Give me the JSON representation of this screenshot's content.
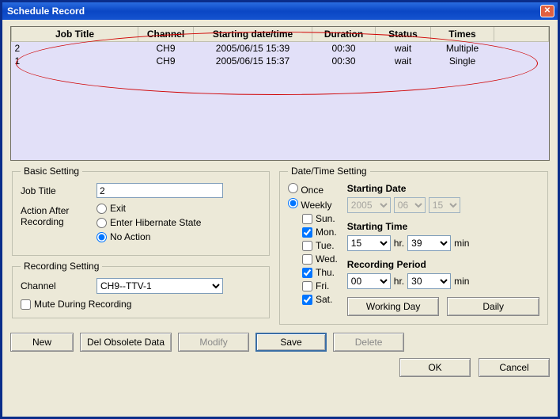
{
  "window": {
    "title": "Schedule Record"
  },
  "table": {
    "headers": {
      "job_title": "Job Title",
      "channel": "Channel",
      "starting": "Starting date/time",
      "duration": "Duration",
      "status": "Status",
      "times": "Times"
    },
    "rows": [
      {
        "job_title": "2",
        "channel": "CH9",
        "starting": "2005/06/15 15:39",
        "duration": "00:30",
        "status": "wait",
        "times": "Multiple"
      },
      {
        "job_title": "1",
        "channel": "CH9",
        "starting": "2005/06/15 15:37",
        "duration": "00:30",
        "status": "wait",
        "times": "Single"
      }
    ]
  },
  "basic": {
    "legend": "Basic Setting",
    "job_title_label": "Job Title",
    "job_title_value": "2",
    "action_label": "Action After Recording",
    "opt_exit": "Exit",
    "opt_hibernate": "Enter Hibernate State",
    "opt_noaction": "No Action"
  },
  "recording": {
    "legend": "Recording Setting",
    "channel_label": "Channel",
    "channel_value": "CH9--TTV-1",
    "mute_label": "Mute During Recording"
  },
  "datetime": {
    "legend": "Date/Time Setting",
    "once_label": "Once",
    "weekly_label": "Weekly",
    "days": {
      "sun": "Sun.",
      "mon": "Mon.",
      "tue": "Tue.",
      "wed": "Wed.",
      "thu": "Thu.",
      "fri": "Fri.",
      "sat": "Sat."
    },
    "starting_date_label": "Starting Date",
    "date_year": "2005",
    "date_month": "06",
    "date_day": "15",
    "starting_time_label": "Starting Time",
    "time_hr": "15",
    "time_min": "39",
    "hr_label": "hr.",
    "min_label": "min",
    "period_label": "Recording Period",
    "period_hr": "00",
    "period_min": "30",
    "working_day_btn": "Working Day",
    "daily_btn": "Daily"
  },
  "buttons": {
    "new": "New",
    "del_obsolete": "Del Obsolete Data",
    "modify": "Modify",
    "save": "Save",
    "delete": "Delete",
    "ok": "OK",
    "cancel": "Cancel"
  }
}
